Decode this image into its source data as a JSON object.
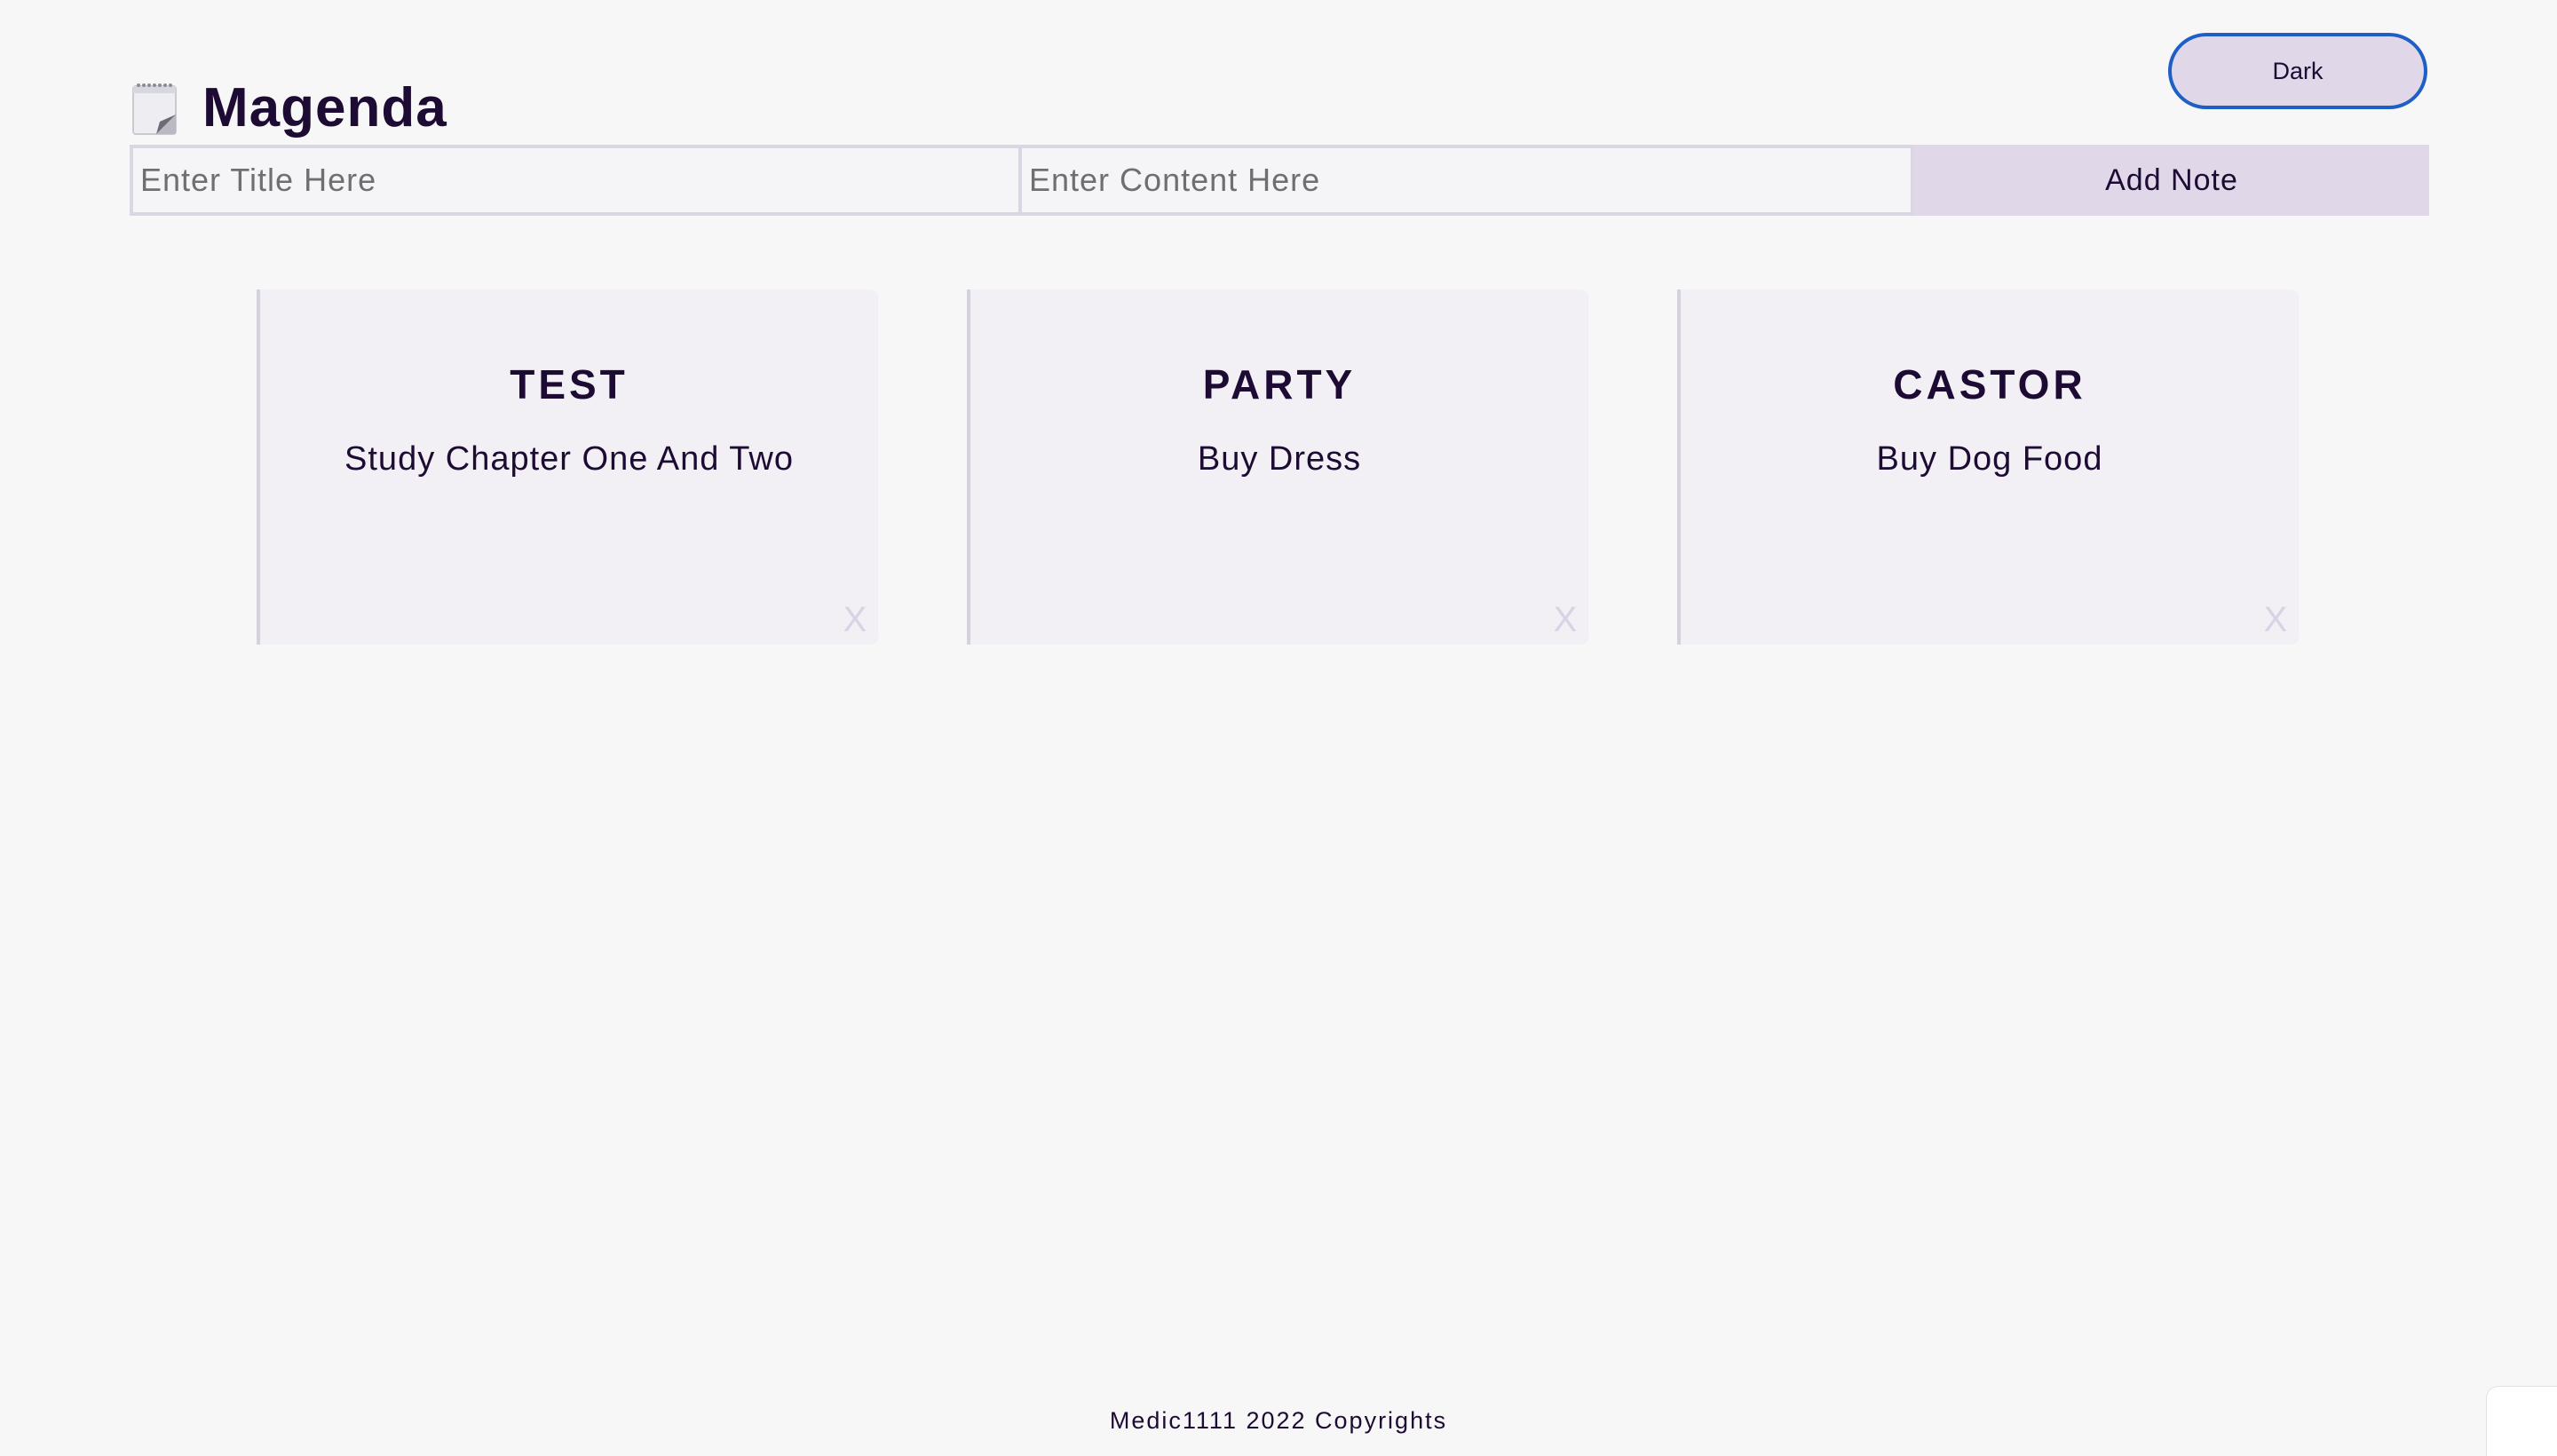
{
  "app": {
    "title": "Magenda",
    "logo_icon": "notepad-icon",
    "theme_toggle_label": "Dark"
  },
  "form": {
    "title_placeholder": "Enter Title Here",
    "content_placeholder": "Enter Content Here",
    "add_button_label": "Add Note"
  },
  "notes": [
    {
      "title": "TEST",
      "content": "Study Chapter One And Two",
      "delete_label": "X"
    },
    {
      "title": "PARTY",
      "content": "Buy Dress",
      "delete_label": "X"
    },
    {
      "title": "CASTOR",
      "content": "Buy Dog Food",
      "delete_label": "X"
    }
  ],
  "footer": {
    "text": "Medic1111 2022 Copyrights"
  },
  "colors": {
    "background": "#f7f7f8",
    "text": "#1d0b33",
    "accent_button": "#e0d8e8",
    "toggle_border": "#1e5fc5",
    "card_background": "#f2f0f5"
  }
}
